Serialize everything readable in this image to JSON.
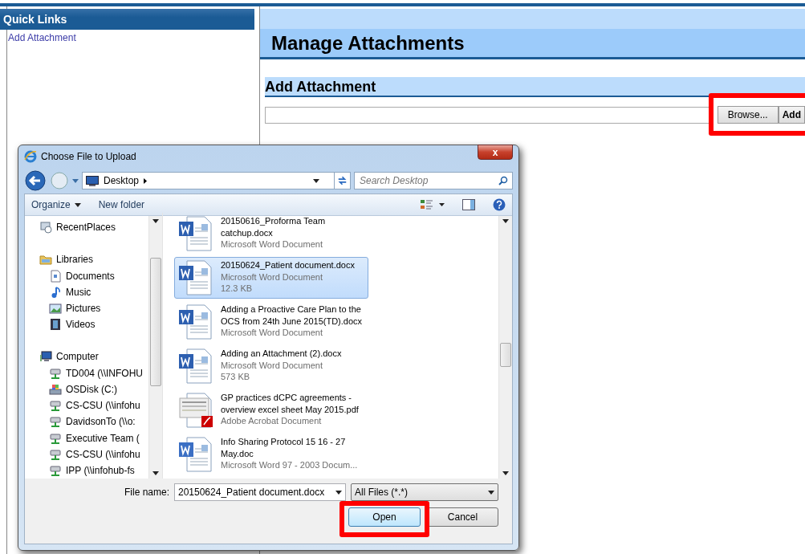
{
  "sidebar": {
    "title": "Quick Links",
    "links": [
      "Add Attachment"
    ]
  },
  "main": {
    "title": "Manage Attachments",
    "section": "Add Attachment",
    "file_input": {
      "browse": "Browse...",
      "highlighted": true
    },
    "add_button": "Add"
  },
  "dialog": {
    "title": "Choose File to Upload",
    "close": "x",
    "breadcrumb": [
      "Desktop"
    ],
    "search": {
      "placeholder": "Search Desktop"
    },
    "toolbar": [
      "Organize",
      "New folder"
    ],
    "nav": [
      {
        "kind": "recent",
        "label": "RecentPlaces"
      },
      {
        "kind": "library",
        "label": "Libraries",
        "children": [
          {
            "kind": "documents",
            "label": "Documents"
          },
          {
            "kind": "music",
            "label": "Music"
          },
          {
            "kind": "pictures",
            "label": "Pictures"
          },
          {
            "kind": "videos",
            "label": "Videos"
          }
        ]
      },
      {
        "kind": "computer",
        "label": "Computer",
        "children": [
          {
            "kind": "network",
            "label": "TD004 (\\\\INFOHU"
          },
          {
            "kind": "disk",
            "label": "OSDisk (C:)"
          },
          {
            "kind": "network",
            "label": "CS-CSU (\\\\infohu"
          },
          {
            "kind": "network",
            "label": "DavidsonTo (\\\\o:"
          },
          {
            "kind": "network",
            "label": "Executive Team ("
          },
          {
            "kind": "network",
            "label": "CS-CSU (\\\\infohu"
          },
          {
            "kind": "network",
            "label": "IPP (\\\\infohub-fs"
          }
        ]
      }
    ],
    "files": [
      {
        "kind": "word",
        "name": "20150616_Proforma Team catchup.docx",
        "type": "Microsoft Word Document",
        "selected": false
      },
      {
        "kind": "word",
        "name": "20150624_Patient document.docx",
        "type": "Microsoft Word Document",
        "size": "12.3 KB",
        "selected": true
      },
      {
        "kind": "word",
        "name": "Adding a Proactive Care Plan to the OCS from 24th June 2015(TD).docx",
        "type": "Microsoft Word Document",
        "selected": false
      },
      {
        "kind": "word",
        "name": "Adding an Attachment (2).docx",
        "type": "Microsoft Word Document",
        "size": "573 KB",
        "selected": false
      },
      {
        "kind": "pdf",
        "name": "GP practices dCPC agreements - overview excel sheet May 2015.pdf",
        "type": "Adobe Acrobat Document",
        "selected": false
      },
      {
        "kind": "word97",
        "name": "Info Sharing Protocol 15 16 - 27 May.doc",
        "type": "Microsoft Word 97 - 2003 Docum...",
        "selected": false
      }
    ],
    "file_name_label": "File name:",
    "file_name": "20150624_Patient document.docx",
    "filter": "All Files (*.*)",
    "open": "Open",
    "open_highlighted": true,
    "cancel": "Cancel"
  }
}
